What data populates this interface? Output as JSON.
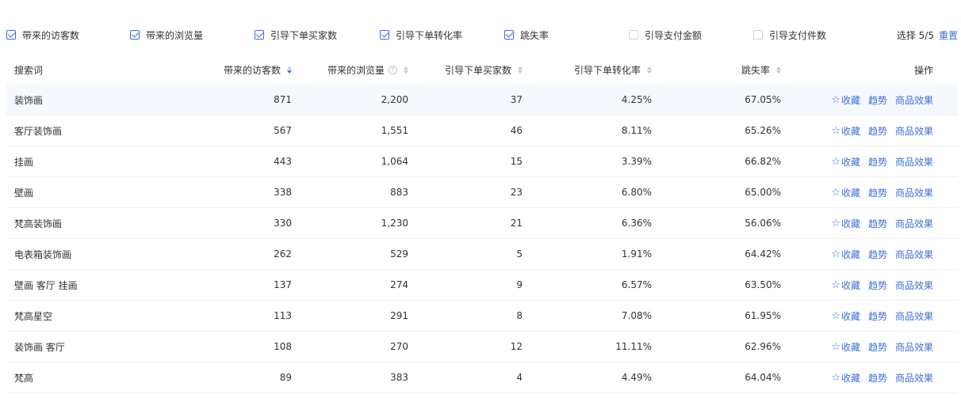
{
  "filters": {
    "items": [
      {
        "label": "带来的访客数",
        "checked": true
      },
      {
        "label": "带来的浏览量",
        "checked": true
      },
      {
        "label": "引导下单买家数",
        "checked": true
      },
      {
        "label": "引导下单转化率",
        "checked": true
      },
      {
        "label": "跳失率",
        "checked": true
      },
      {
        "label": "引导支付金额",
        "checked": false
      },
      {
        "label": "引导支付件数",
        "checked": false
      }
    ],
    "selected_text": "选择 5/5",
    "reset_label": "重置"
  },
  "table": {
    "headers": {
      "keyword": "搜索词",
      "visitors": "带来的访客数",
      "views": "带来的浏览量",
      "buyers": "引导下单买家数",
      "conversion": "引导下单转化率",
      "bounce": "跳失率",
      "actions": "操作"
    },
    "help_symbol": "?",
    "action_labels": {
      "favorite": "收藏",
      "trend": "趋势",
      "effect": "商品效果"
    },
    "star_icon": "☆",
    "accent_color": "#3d6fd9",
    "rows": [
      {
        "keyword": "装饰画",
        "visitors": "871",
        "views": "2,200",
        "buyers": "37",
        "conversion": "4.25%",
        "bounce": "67.05%"
      },
      {
        "keyword": "客厅装饰画",
        "visitors": "567",
        "views": "1,551",
        "buyers": "46",
        "conversion": "8.11%",
        "bounce": "65.26%"
      },
      {
        "keyword": "挂画",
        "visitors": "443",
        "views": "1,064",
        "buyers": "15",
        "conversion": "3.39%",
        "bounce": "66.82%"
      },
      {
        "keyword": "壁画",
        "visitors": "338",
        "views": "883",
        "buyers": "23",
        "conversion": "6.80%",
        "bounce": "65.00%"
      },
      {
        "keyword": "梵高装饰画",
        "visitors": "330",
        "views": "1,230",
        "buyers": "21",
        "conversion": "6.36%",
        "bounce": "56.06%"
      },
      {
        "keyword": "电表箱装饰画",
        "visitors": "262",
        "views": "529",
        "buyers": "5",
        "conversion": "1.91%",
        "bounce": "64.42%"
      },
      {
        "keyword": "壁画 客厅 挂画",
        "visitors": "137",
        "views": "274",
        "buyers": "9",
        "conversion": "6.57%",
        "bounce": "63.50%"
      },
      {
        "keyword": "梵高星空",
        "visitors": "113",
        "views": "291",
        "buyers": "8",
        "conversion": "7.08%",
        "bounce": "61.95%"
      },
      {
        "keyword": "装饰画 客厅",
        "visitors": "108",
        "views": "270",
        "buyers": "12",
        "conversion": "11.11%",
        "bounce": "62.96%"
      },
      {
        "keyword": "梵高",
        "visitors": "89",
        "views": "383",
        "buyers": "4",
        "conversion": "4.49%",
        "bounce": "64.04%"
      }
    ]
  }
}
